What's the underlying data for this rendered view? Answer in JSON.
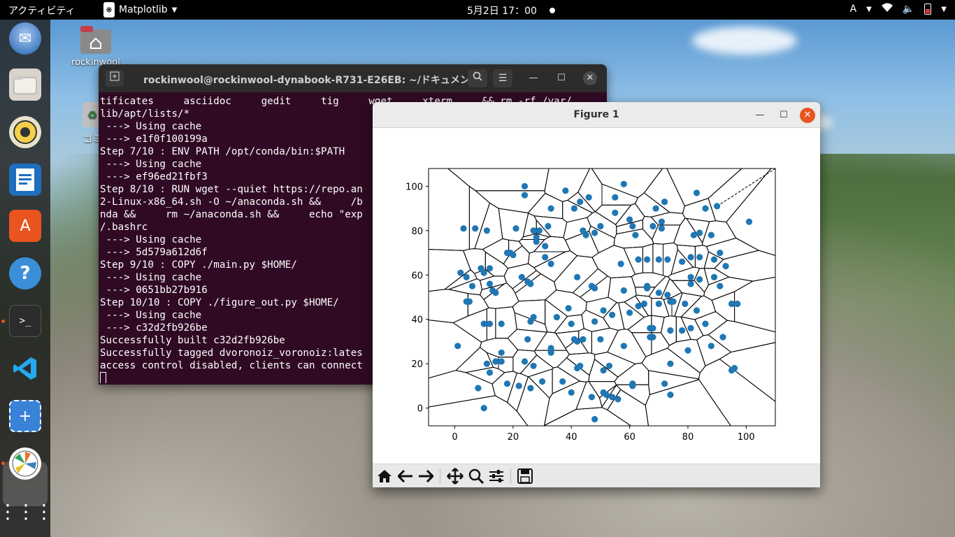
{
  "topbar": {
    "activities": "アクティビティ",
    "app_name": "Matplotlib",
    "clock": "5月2日  17：00",
    "input_method": "A"
  },
  "desktop": {
    "home_label": "rockinwool",
    "trash_label": "ゴミ"
  },
  "terminal": {
    "title": "rockinwool@rockinwool-dynabook-R731-E26EB: ~/ドキュメン…",
    "lines": [
      "tificates     asciidoc     gedit     tig     wget     xterm     && rm -rf /var/",
      "lib/apt/lists/*",
      " ---> Using cache",
      " ---> e1f0f100199a",
      "Step 7/10 : ENV PATH /opt/conda/bin:$PATH",
      " ---> Using cache",
      " ---> ef96ed21fbf3",
      "Step 8/10 : RUN wget --quiet https://repo.an",
      "2-Linux-x86_64.sh -O ~/anaconda.sh &&     /b",
      "nda &&     rm ~/anaconda.sh &&     echo \"exp",
      "/.bashrc",
      " ---> Using cache",
      " ---> 5d579a612d6f",
      "Step 9/10 : COPY ./main.py $HOME/",
      " ---> Using cache",
      " ---> 0651bb27b916",
      "Step 10/10 : COPY ./figure_out.py $HOME/",
      " ---> Using cache",
      " ---> c32d2fb926be",
      "Successfully built c32d2fb926be",
      "Successfully tagged dvoronoiz_voronoiz:lates",
      "access control disabled, clients can connect"
    ]
  },
  "figure": {
    "title": "Figure 1"
  },
  "chart_data": {
    "type": "scatter",
    "title": "",
    "xlabel": "",
    "ylabel": "",
    "xlim": [
      -9,
      110
    ],
    "ylim": [
      -8,
      108
    ],
    "xticks": [
      0,
      20,
      40,
      60,
      80,
      100
    ],
    "yticks": [
      0,
      20,
      40,
      60,
      80,
      100
    ],
    "point_color": "#1f77b4",
    "edge_color": "#000000",
    "points": [
      [
        24,
        100
      ],
      [
        24,
        96
      ],
      [
        38,
        98
      ],
      [
        43,
        93
      ],
      [
        46,
        95
      ],
      [
        41,
        90
      ],
      [
        33,
        90
      ],
      [
        55,
        95
      ],
      [
        58,
        101
      ],
      [
        69,
        90
      ],
      [
        72,
        93
      ],
      [
        83,
        97
      ],
      [
        86,
        90
      ],
      [
        90,
        91
      ],
      [
        101,
        84
      ],
      [
        3,
        81
      ],
      [
        7,
        81
      ],
      [
        11,
        80
      ],
      [
        21,
        81
      ],
      [
        27,
        80
      ],
      [
        29,
        80
      ],
      [
        32,
        82
      ],
      [
        44,
        80
      ],
      [
        45,
        78
      ],
      [
        48,
        79
      ],
      [
        50,
        82
      ],
      [
        55,
        88
      ],
      [
        60,
        85
      ],
      [
        61,
        82
      ],
      [
        62,
        78
      ],
      [
        68,
        82
      ],
      [
        71,
        84
      ],
      [
        71,
        81
      ],
      [
        82,
        78
      ],
      [
        84,
        79
      ],
      [
        88,
        78
      ],
      [
        18,
        70
      ],
      [
        19,
        70
      ],
      [
        20,
        69
      ],
      [
        28,
        75
      ],
      [
        31,
        73
      ],
      [
        31,
        68
      ],
      [
        33,
        65
      ],
      [
        28,
        77
      ],
      [
        57,
        65
      ],
      [
        63,
        67
      ],
      [
        66,
        67
      ],
      [
        70,
        67
      ],
      [
        73,
        67
      ],
      [
        78,
        66
      ],
      [
        81,
        68
      ],
      [
        84,
        68
      ],
      [
        89,
        67
      ],
      [
        91,
        70
      ],
      [
        93,
        64
      ],
      [
        2,
        61
      ],
      [
        4,
        59
      ],
      [
        6,
        55
      ],
      [
        9,
        63
      ],
      [
        10,
        61
      ],
      [
        12,
        63
      ],
      [
        12,
        56
      ],
      [
        13,
        53
      ],
      [
        14,
        52
      ],
      [
        23,
        59
      ],
      [
        25,
        57
      ],
      [
        26,
        56
      ],
      [
        42,
        59
      ],
      [
        47,
        55
      ],
      [
        48,
        54
      ],
      [
        58,
        53
      ],
      [
        66,
        54
      ],
      [
        66,
        55
      ],
      [
        70,
        52
      ],
      [
        73,
        51
      ],
      [
        81,
        59
      ],
      [
        81,
        56
      ],
      [
        84,
        58
      ],
      [
        89,
        59
      ],
      [
        91,
        55
      ],
      [
        4,
        48
      ],
      [
        5,
        48
      ],
      [
        10,
        38
      ],
      [
        12,
        38
      ],
      [
        16,
        38
      ],
      [
        27,
        41
      ],
      [
        26,
        39
      ],
      [
        35,
        41
      ],
      [
        39,
        45
      ],
      [
        40,
        38
      ],
      [
        48,
        39
      ],
      [
        51,
        44
      ],
      [
        54,
        42
      ],
      [
        60,
        43
      ],
      [
        63,
        46
      ],
      [
        65,
        47
      ],
      [
        70,
        47
      ],
      [
        74,
        48
      ],
      [
        75,
        48
      ],
      [
        79,
        47
      ],
      [
        83,
        44
      ],
      [
        95,
        47
      ],
      [
        97,
        47
      ],
      [
        1,
        28
      ],
      [
        16,
        25
      ],
      [
        11,
        20
      ],
      [
        14,
        21
      ],
      [
        16,
        21
      ],
      [
        25,
        31
      ],
      [
        24,
        21
      ],
      [
        27,
        19
      ],
      [
        33,
        27
      ],
      [
        33,
        25
      ],
      [
        41,
        31
      ],
      [
        42,
        30
      ],
      [
        44,
        31
      ],
      [
        50,
        31
      ],
      [
        58,
        28
      ],
      [
        67,
        32
      ],
      [
        67,
        36
      ],
      [
        68,
        36
      ],
      [
        68,
        32
      ],
      [
        74,
        35
      ],
      [
        78,
        35
      ],
      [
        81,
        36
      ],
      [
        86,
        38
      ],
      [
        88,
        28
      ],
      [
        92,
        32
      ],
      [
        80,
        26
      ],
      [
        95,
        17
      ],
      [
        96,
        18
      ],
      [
        74,
        20
      ],
      [
        8,
        9
      ],
      [
        12,
        16
      ],
      [
        18,
        11
      ],
      [
        22,
        10
      ],
      [
        26,
        9
      ],
      [
        30,
        12
      ],
      [
        37,
        12
      ],
      [
        40,
        7
      ],
      [
        42,
        18
      ],
      [
        43,
        19
      ],
      [
        51,
        17
      ],
      [
        53,
        19
      ],
      [
        51,
        7
      ],
      [
        52,
        6
      ],
      [
        54,
        5
      ],
      [
        56,
        4
      ],
      [
        61,
        11
      ],
      [
        61,
        10
      ],
      [
        72,
        11
      ],
      [
        74,
        6
      ],
      [
        10,
        0
      ],
      [
        47,
        5
      ],
      [
        48,
        -5
      ]
    ],
    "ridge_dashed_end": [
      110,
      108
    ]
  }
}
